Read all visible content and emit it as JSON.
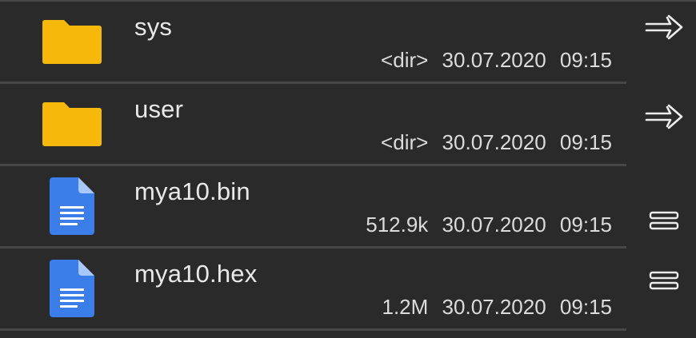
{
  "files": [
    {
      "name": "sys",
      "size": "<dir>",
      "date": "30.07.2020",
      "time": "09:15",
      "type": "folder",
      "action_icon": "arrow-right-icon"
    },
    {
      "name": "user",
      "size": "<dir>",
      "date": "30.07.2020",
      "time": "09:15",
      "type": "folder",
      "action_icon": "arrow-right-icon"
    },
    {
      "name": "mya10.bin",
      "size": "512.9k",
      "date": "30.07.2020",
      "time": "09:15",
      "type": "document",
      "action_icon": "menu-icon"
    },
    {
      "name": "mya10.hex",
      "size": "1.2M",
      "date": "30.07.2020",
      "time": "09:15",
      "type": "document",
      "action_icon": "menu-icon"
    }
  ],
  "colors": {
    "background": "#2a2a2a",
    "divider": "#474747",
    "folder": "#f6b80b",
    "document": "#3b7de9",
    "text": "#e9e9e9"
  }
}
